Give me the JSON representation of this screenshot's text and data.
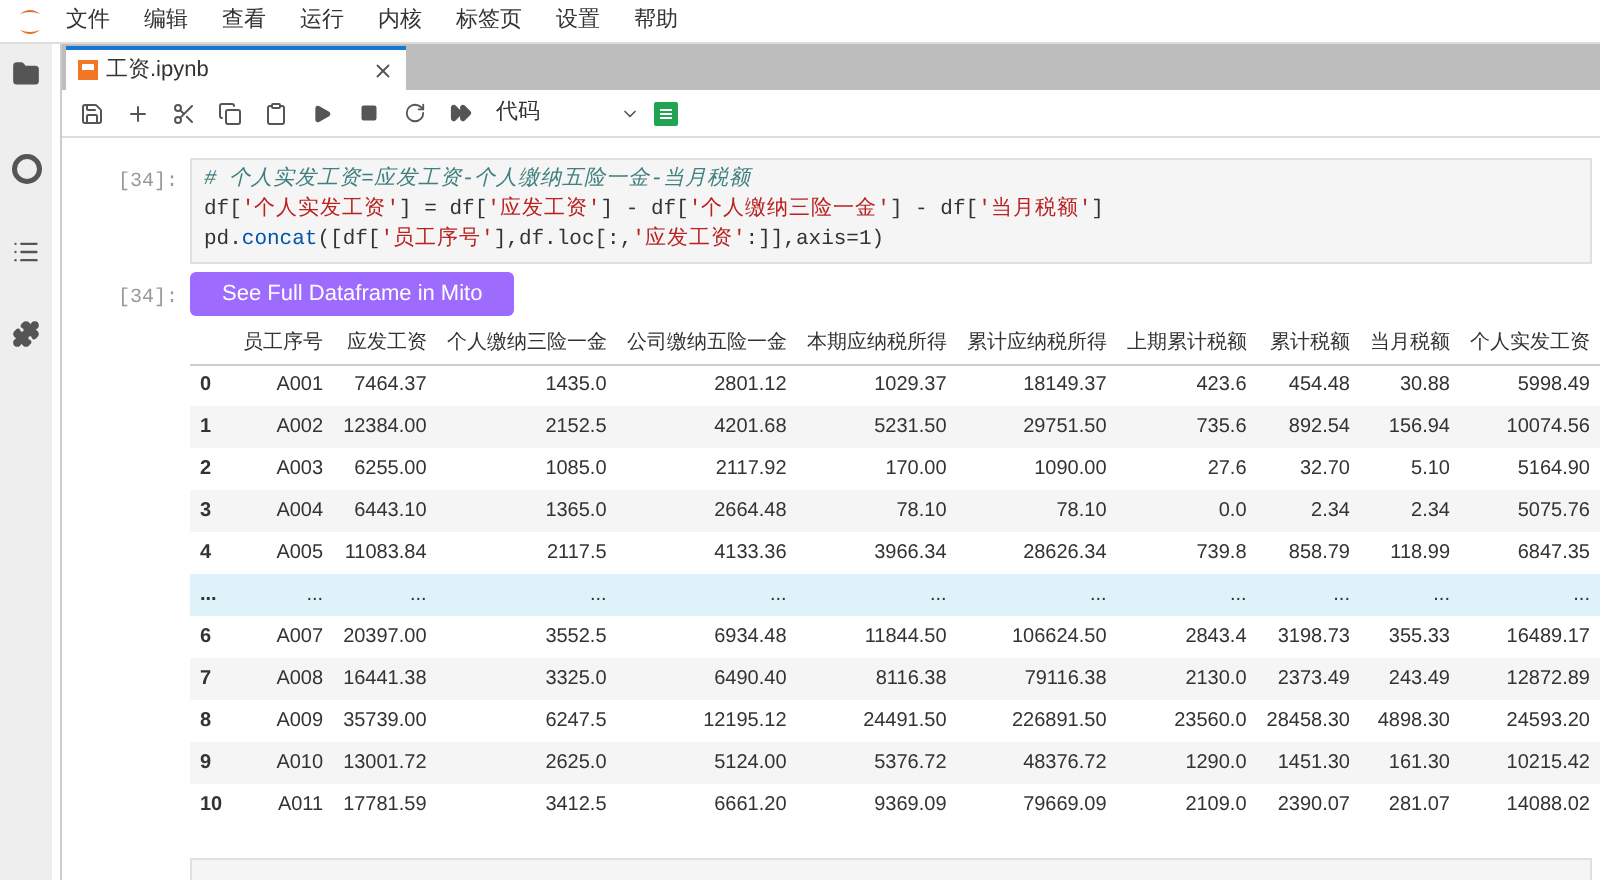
{
  "menu": [
    "文件",
    "编辑",
    "查看",
    "运行",
    "内核",
    "标签页",
    "设置",
    "帮助"
  ],
  "tab": {
    "title": "工资.ipynb",
    "selected": true
  },
  "toolbar": {
    "cell_type": "代码"
  },
  "code_cell": {
    "prompt": "[34]:",
    "lines": [
      [
        {
          "kind": "comment",
          "text": "# 个人实发工资=应发工资-个人缴纳五险一金-当月税额"
        }
      ],
      [
        {
          "kind": "plain",
          "text": "df["
        },
        {
          "kind": "string",
          "text": "'个人实发工资'"
        },
        {
          "kind": "plain",
          "text": "] = df["
        },
        {
          "kind": "string",
          "text": "'应发工资'"
        },
        {
          "kind": "plain",
          "text": "] - df["
        },
        {
          "kind": "string",
          "text": "'个人缴纳三险一金'"
        },
        {
          "kind": "plain",
          "text": "] - df["
        },
        {
          "kind": "string",
          "text": "'当月税额'"
        },
        {
          "kind": "plain",
          "text": "]"
        }
      ],
      [
        {
          "kind": "plain",
          "text": "pd."
        },
        {
          "kind": "func",
          "text": "concat"
        },
        {
          "kind": "plain",
          "text": "([df["
        },
        {
          "kind": "string",
          "text": "'员工序号'"
        },
        {
          "kind": "plain",
          "text": "],df.loc[:,"
        },
        {
          "kind": "string",
          "text": "'应发工资'"
        },
        {
          "kind": "plain",
          "text": ":]],axis=1)"
        }
      ]
    ]
  },
  "output_cell": {
    "prompt": "[34]:",
    "button": "See Full Dataframe in Mito",
    "table": {
      "columns": [
        "员工序号",
        "应发工资",
        "个人缴纳三险一金",
        "公司缴纳五险一金",
        "本期应纳税所得",
        "累计应纳税所得",
        "上期累计税额",
        "累计税额",
        "当月税额",
        "个人实发工资"
      ],
      "rows": [
        {
          "kind": "data",
          "index": "0",
          "cells": [
            "A001",
            "7464.37",
            "1435.0",
            "2801.12",
            "1029.37",
            "18149.37",
            "423.6",
            "454.48",
            "30.88",
            "5998.49"
          ]
        },
        {
          "kind": "data",
          "index": "1",
          "cells": [
            "A002",
            "12384.00",
            "2152.5",
            "4201.68",
            "5231.50",
            "29751.50",
            "735.6",
            "892.54",
            "156.94",
            "10074.56"
          ]
        },
        {
          "kind": "data",
          "index": "2",
          "cells": [
            "A003",
            "6255.00",
            "1085.0",
            "2117.92",
            "170.00",
            "1090.00",
            "27.6",
            "32.70",
            "5.10",
            "5164.90"
          ]
        },
        {
          "kind": "data",
          "index": "3",
          "cells": [
            "A004",
            "6443.10",
            "1365.0",
            "2664.48",
            "78.10",
            "78.10",
            "0.0",
            "2.34",
            "2.34",
            "5075.76"
          ]
        },
        {
          "kind": "data",
          "index": "4",
          "cells": [
            "A005",
            "11083.84",
            "2117.5",
            "4133.36",
            "3966.34",
            "28626.34",
            "739.8",
            "858.79",
            "118.99",
            "6847.35"
          ]
        },
        {
          "kind": "ellipsis",
          "index": "...",
          "cells": [
            "...",
            "...",
            "...",
            "...",
            "...",
            "...",
            "...",
            "...",
            "...",
            "..."
          ]
        },
        {
          "kind": "data",
          "index": "6",
          "cells": [
            "A007",
            "20397.00",
            "3552.5",
            "6934.48",
            "11844.50",
            "106624.50",
            "2843.4",
            "3198.73",
            "355.33",
            "16489.17"
          ]
        },
        {
          "kind": "data",
          "index": "7",
          "cells": [
            "A008",
            "16441.38",
            "3325.0",
            "6490.40",
            "8116.38",
            "79116.38",
            "2130.0",
            "2373.49",
            "243.49",
            "12872.89"
          ]
        },
        {
          "kind": "data",
          "index": "8",
          "cells": [
            "A009",
            "35739.00",
            "6247.5",
            "12195.12",
            "24491.50",
            "226891.50",
            "23560.0",
            "28458.30",
            "4898.30",
            "24593.20"
          ]
        },
        {
          "kind": "data",
          "index": "9",
          "cells": [
            "A010",
            "13001.72",
            "2625.0",
            "5124.00",
            "5376.72",
            "48376.72",
            "1290.0",
            "1451.30",
            "161.30",
            "10215.42"
          ]
        },
        {
          "kind": "data",
          "index": "10",
          "cells": [
            "A011",
            "17781.59",
            "3412.5",
            "6661.20",
            "9369.09",
            "79669.09",
            "2109.0",
            "2390.07",
            "281.07",
            "14088.02"
          ]
        }
      ]
    }
  }
}
